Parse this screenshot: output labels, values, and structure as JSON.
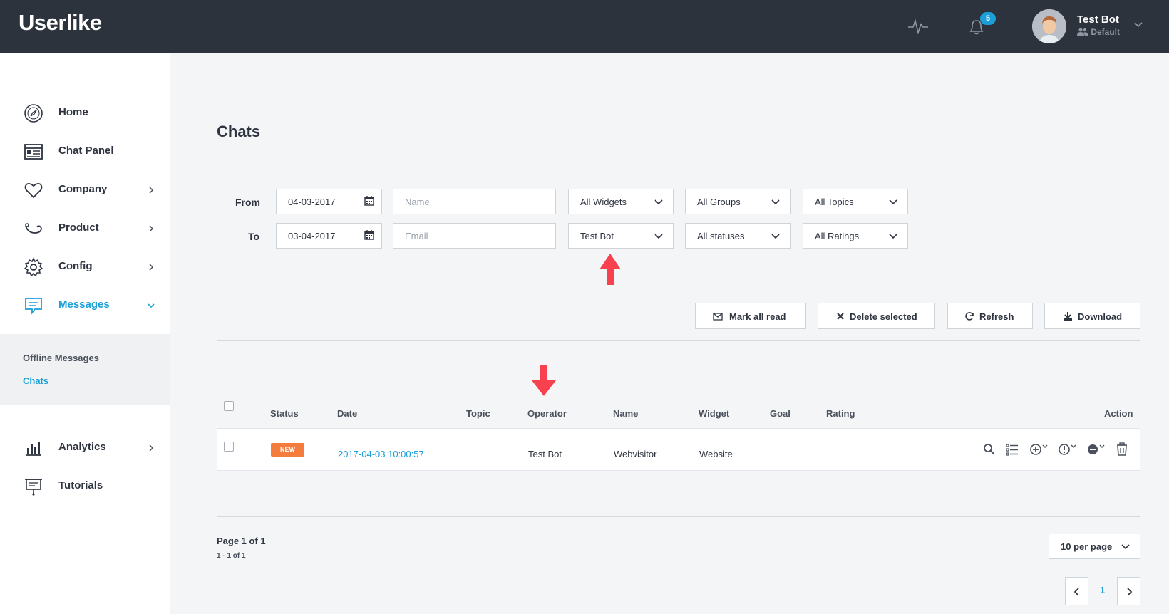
{
  "header": {
    "logo": "Userlike",
    "notifications_count": "5",
    "user_name": "Test Bot",
    "user_group": "Default"
  },
  "sidebar": {
    "items": [
      {
        "label": "Home",
        "icon": "compass-icon"
      },
      {
        "label": "Chat Panel",
        "icon": "chat-panel-icon"
      },
      {
        "label": "Company",
        "icon": "heart-icon"
      },
      {
        "label": "Product",
        "icon": "product-icon"
      },
      {
        "label": "Config",
        "icon": "gear-icon"
      },
      {
        "label": "Messages",
        "icon": "message-icon"
      },
      {
        "label": "Analytics",
        "icon": "bar-chart-icon"
      },
      {
        "label": "Tutorials",
        "icon": "presentation-icon"
      }
    ],
    "subitems": [
      "Offline Messages",
      "Chats"
    ]
  },
  "page": {
    "title": "Chats"
  },
  "filters": {
    "from_label": "From",
    "to_label": "To",
    "from_date": "04-03-2017",
    "to_date": "03-04-2017",
    "name_placeholder": "Name",
    "email_placeholder": "Email",
    "widgets": "All Widgets",
    "operator": "Test Bot",
    "groups": "All Groups",
    "statuses": "All statuses",
    "topics": "All Topics",
    "ratings": "All Ratings"
  },
  "actions": {
    "mark_all_read": "Mark all read",
    "delete_selected": "Delete selected",
    "refresh": "Refresh",
    "download": "Download"
  },
  "table": {
    "columns": [
      "Status",
      "Date",
      "Topic",
      "Operator",
      "Name",
      "Widget",
      "Goal",
      "Rating",
      "Action"
    ],
    "rows": [
      {
        "status": "NEW",
        "date": "2017-04-03 10:00:57",
        "topic": "",
        "operator": "Test Bot",
        "name": "Webvisitor",
        "widget": "Website",
        "goal": "",
        "rating": ""
      }
    ]
  },
  "pagination": {
    "page_info": "Page 1 of 1",
    "count": "1 - 1 of 1",
    "per_page": "10 per page",
    "current_page": "1"
  },
  "colors": {
    "accent": "#1a9fd8",
    "header_bg": "#2c333d",
    "annotation_arrow": "#f8414f",
    "new_badge": "#f47c3c"
  }
}
